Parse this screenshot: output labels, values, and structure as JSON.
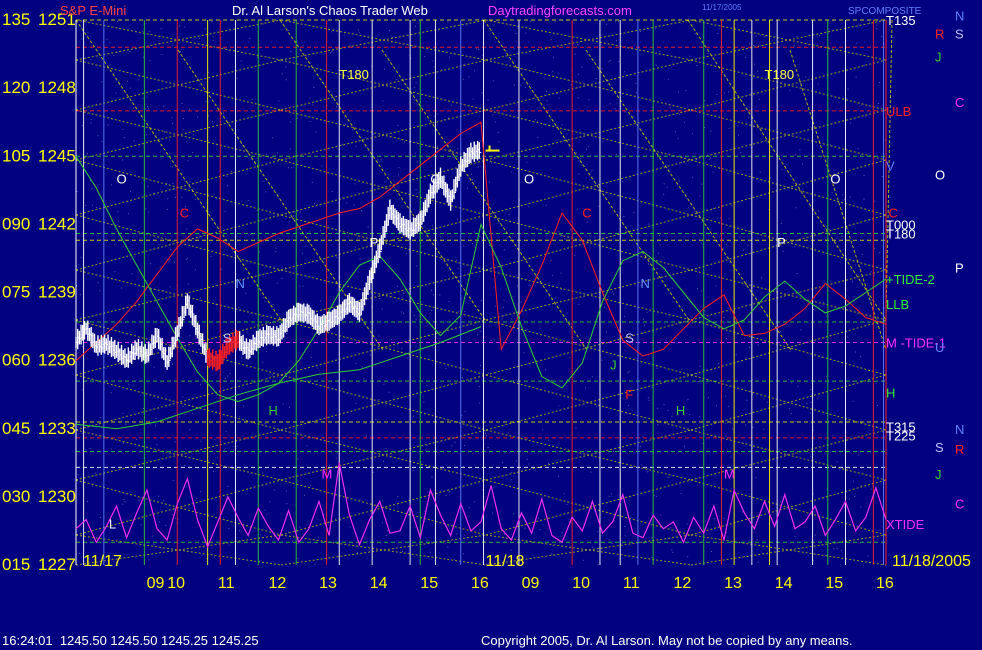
{
  "header": {
    "instrument": "S&P E-Mini",
    "title": "Dr. Al Larson's Chaos Trader Web",
    "site": "Daytradingforecasts.com",
    "small_stamp": "11/17/2005",
    "corner_label": "SPCOMPOSITE"
  },
  "footer": {
    "quote": "16:24:01  1245.50 1245.50 1245.25 1245.25",
    "copyright": "Copyright 2005, Dr. Al Larson. May not be copied by any means."
  },
  "colors": {
    "background": "#000080",
    "axis_text": "#ffff00",
    "price_bars": "#ffffff",
    "red_band": "#ff2020",
    "green_band": "#33cc33",
    "xtide": "#ee30ee",
    "yellow_grid": "#e8e800",
    "header_left": "#ff4444",
    "header_site": "#ff44ff"
  },
  "chart_data": {
    "type": "line",
    "y_left": {
      "ticks": [
        {
          "deg": "135",
          "price": "1251",
          "value": 1251
        },
        {
          "deg": "120",
          "price": "1248",
          "value": 1248
        },
        {
          "deg": "105",
          "price": "1245",
          "value": 1245
        },
        {
          "deg": "090",
          "price": "1242",
          "value": 1242
        },
        {
          "deg": "075",
          "price": "1239",
          "value": 1239
        },
        {
          "deg": "060",
          "price": "1236",
          "value": 1236
        },
        {
          "deg": "045",
          "price": "1233",
          "value": 1233
        },
        {
          "deg": "030",
          "price": "1230",
          "value": 1230
        },
        {
          "deg": "015",
          "price": "1227",
          "value": 1227
        }
      ],
      "ylim": [
        1227,
        1251
      ]
    },
    "x_axis": {
      "xlim": [
        8.0,
        24.0
      ],
      "hour_ticks": [
        {
          "label": "09",
          "x": 9
        },
        {
          "label": "10",
          "x": 10
        },
        {
          "label": "11",
          "x": 11
        },
        {
          "label": "12",
          "x": 12
        },
        {
          "label": "13",
          "x": 13
        },
        {
          "label": "14",
          "x": 14
        },
        {
          "label": "15",
          "x": 15
        },
        {
          "label": "16",
          "x": 16
        },
        {
          "label": "09",
          "x": 17
        },
        {
          "label": "10",
          "x": 18
        },
        {
          "label": "11",
          "x": 19
        },
        {
          "label": "12",
          "x": 20
        },
        {
          "label": "13",
          "x": 21
        },
        {
          "label": "14",
          "x": 22
        },
        {
          "label": "15",
          "x": 23
        },
        {
          "label": "16",
          "x": 24
        }
      ],
      "date_labels": [
        {
          "label": "11/17",
          "x": 8.1
        },
        {
          "label": "11/18",
          "x": 16.05
        },
        {
          "label": "11/18/2005",
          "x": 24.0
        }
      ]
    },
    "price_series": {
      "name": "",
      "x": [
        8.0,
        8.2,
        8.4,
        8.6,
        8.8,
        9.0,
        9.2,
        9.4,
        9.6,
        9.8,
        10.0,
        10.2,
        10.4,
        10.6,
        10.8,
        11.0,
        11.2,
        11.4,
        11.6,
        11.8,
        12.0,
        12.2,
        12.4,
        12.6,
        12.8,
        13.0,
        13.2,
        13.4,
        13.6,
        13.8,
        14.0,
        14.2,
        14.4,
        14.6,
        14.8,
        15.0,
        15.2,
        15.4,
        15.6,
        15.8,
        16.0
      ],
      "y": [
        1236.8,
        1237.4,
        1236.6,
        1236.7,
        1236.4,
        1236.0,
        1236.5,
        1236.2,
        1237.1,
        1235.9,
        1237.2,
        1238.6,
        1237.3,
        1236.1,
        1235.9,
        1236.6,
        1236.9,
        1236.4,
        1236.9,
        1237.1,
        1237.0,
        1237.8,
        1238.1,
        1238.0,
        1237.5,
        1237.7,
        1238.0,
        1238.5,
        1238.1,
        1239.5,
        1240.9,
        1242.6,
        1242.0,
        1241.7,
        1242.1,
        1243.3,
        1244.0,
        1243.0,
        1244.5,
        1245.1,
        1245.25
      ]
    },
    "red_section": {
      "x_start": 10.6,
      "x_end": 11.2
    },
    "last_price": {
      "x": 16.05,
      "value": 1245.25
    },
    "series": [
      {
        "name": "",
        "color": "#ff2020",
        "x": [
          8.0,
          8.4,
          8.8,
          9.2,
          9.6,
          10.0,
          10.4,
          10.8,
          11.2,
          11.6,
          12.0,
          12.4,
          12.8,
          13.2,
          13.6,
          14.0,
          14.4,
          14.8,
          15.2,
          15.6,
          16.0,
          16.4,
          16.8,
          17.2,
          17.6,
          18.0,
          18.4,
          18.8,
          19.2,
          19.6,
          20.0,
          20.4,
          20.8,
          21.2,
          21.6,
          22.0,
          22.4,
          22.8,
          23.2,
          23.6,
          24.0
        ],
        "y": [
          1236.0,
          1236.8,
          1237.6,
          1238.6,
          1239.8,
          1241.0,
          1241.8,
          1241.4,
          1240.8,
          1241.2,
          1241.6,
          1241.9,
          1242.2,
          1242.5,
          1242.7,
          1243.2,
          1243.9,
          1244.6,
          1245.3,
          1246.0,
          1246.5,
          1236.5,
          1238.2,
          1240.2,
          1242.5,
          1241.3,
          1239.0,
          1236.9,
          1236.2,
          1236.5,
          1237.4,
          1238.3,
          1238.9,
          1237.1,
          1237.2,
          1237.6,
          1238.3,
          1239.4,
          1238.7,
          1237.9,
          1237.6
        ]
      },
      {
        "name": "",
        "color": "#33cc33",
        "x": [
          8.0,
          8.4,
          8.8,
          9.2,
          9.6,
          10.0,
          10.4,
          10.8,
          11.2,
          11.6,
          12.0,
          12.4,
          12.8,
          13.2,
          13.6,
          14.0,
          14.4,
          14.8,
          15.2,
          15.6,
          16.0,
          16.4,
          16.8,
          17.2,
          17.6,
          18.0,
          18.4,
          18.8,
          19.2,
          19.6,
          20.0,
          20.4,
          20.8,
          21.2,
          21.6,
          22.0,
          22.4,
          22.8,
          23.2,
          23.6,
          24.0
        ],
        "y": [
          1245.0,
          1243.6,
          1241.8,
          1240.2,
          1238.6,
          1237.0,
          1235.5,
          1234.5,
          1234.2,
          1234.5,
          1235.0,
          1236.0,
          1237.4,
          1239.0,
          1240.2,
          1240.6,
          1239.6,
          1238.1,
          1237.1,
          1238.0,
          1242.0,
          1240.1,
          1237.5,
          1235.3,
          1234.8,
          1235.9,
          1238.6,
          1240.4,
          1240.8,
          1240.1,
          1239.0,
          1237.9,
          1237.4,
          1237.8,
          1238.8,
          1239.5,
          1238.7,
          1238.1,
          1238.4,
          1239.0,
          1239.6
        ]
      },
      {
        "name": "",
        "color": "#33cc33",
        "x": [
          8.0,
          8.8,
          9.6,
          10.4,
          11.2,
          12.0,
          12.8,
          13.6,
          14.4,
          15.2,
          16.0
        ],
        "y": [
          1233.2,
          1233.0,
          1233.3,
          1233.9,
          1234.5,
          1235.0,
          1235.4,
          1235.6,
          1236.2,
          1236.8,
          1237.5
        ]
      }
    ],
    "xtide": {
      "name": "",
      "color": "#ee30ee",
      "x": [
        8.0,
        8.2,
        8.4,
        8.6,
        8.8,
        9.0,
        9.2,
        9.4,
        9.6,
        9.8,
        10.0,
        10.2,
        10.4,
        10.6,
        10.8,
        11.0,
        11.2,
        11.4,
        11.6,
        11.8,
        12.0,
        12.2,
        12.4,
        12.6,
        12.8,
        13.0,
        13.2,
        13.4,
        13.6,
        13.8,
        14.0,
        14.2,
        14.4,
        14.6,
        14.8,
        15.0,
        15.2,
        15.4,
        15.6,
        15.8,
        16.0,
        16.2,
        16.4,
        16.6,
        16.8,
        17.0,
        17.2,
        17.4,
        17.6,
        17.8,
        18.0,
        18.2,
        18.4,
        18.6,
        18.8,
        19.0,
        19.2,
        19.4,
        19.6,
        19.8,
        20.0,
        20.2,
        20.4,
        20.6,
        20.8,
        21.0,
        21.2,
        21.4,
        21.6,
        21.8,
        22.0,
        22.2,
        22.4,
        22.6,
        22.8,
        23.0,
        23.2,
        23.4,
        23.6,
        23.8,
        24.0
      ],
      "y": [
        1228.6,
        1229.0,
        1228.0,
        1228.7,
        1229.6,
        1228.2,
        1229.3,
        1230.3,
        1228.6,
        1228.1,
        1229.7,
        1230.8,
        1229.0,
        1227.8,
        1228.9,
        1230.0,
        1229.1,
        1228.3,
        1229.5,
        1228.7,
        1228.1,
        1229.4,
        1228.0,
        1228.6,
        1229.8,
        1228.3,
        1231.5,
        1229.2,
        1227.9,
        1229.0,
        1229.8,
        1228.4,
        1228.5,
        1229.6,
        1228.2,
        1230.3,
        1229.2,
        1228.3,
        1229.7,
        1228.5,
        1228.9,
        1230.5,
        1228.6,
        1228.1,
        1229.3,
        1228.4,
        1229.9,
        1228.3,
        1228.0,
        1229.1,
        1228.5,
        1229.8,
        1228.4,
        1228.9,
        1230.1,
        1228.4,
        1228.2,
        1229.2,
        1228.6,
        1228.9,
        1228.0,
        1229.1,
        1228.4,
        1229.6,
        1228.1,
        1230.3,
        1229.3,
        1228.6,
        1229.8,
        1228.7,
        1230.1,
        1228.6,
        1228.9,
        1229.6,
        1228.3,
        1229.0,
        1229.8,
        1228.5,
        1229.1,
        1230.4,
        1229.0
      ]
    },
    "horizontal_levels": [
      {
        "value": 1251.0,
        "color": "#e8e800"
      },
      {
        "value": 1249.8,
        "color": "#ff2020"
      },
      {
        "value": 1247.0,
        "color": "#ff2020"
      },
      {
        "value": 1245.0,
        "color": "#33cc33"
      },
      {
        "value": 1241.6,
        "color": "#33cc33"
      },
      {
        "value": 1241.3,
        "color": "#e8e800"
      },
      {
        "value": 1237.7,
        "color": "#33cc33"
      },
      {
        "value": 1236.8,
        "color": "#ff30ff"
      },
      {
        "value": 1235.1,
        "color": "#33cc33"
      },
      {
        "value": 1233.3,
        "color": "#e8e800"
      },
      {
        "value": 1232.6,
        "color": "#ff2020"
      },
      {
        "value": 1232.0,
        "color": "#33cc33"
      },
      {
        "value": 1231.3,
        "color": "#ffffff"
      },
      {
        "value": 1228.0,
        "color": "#33cc33"
      }
    ],
    "vertical_lines": [
      {
        "x": 8.15,
        "color": "#ffffff"
      },
      {
        "x": 8.55,
        "color": "#6080ff"
      },
      {
        "x": 9.35,
        "color": "#33cc33"
      },
      {
        "x": 10.0,
        "color": "#ff2020"
      },
      {
        "x": 10.6,
        "color": "#ffff00"
      },
      {
        "x": 10.85,
        "color": "#ff2020"
      },
      {
        "x": 11.15,
        "color": "#ffffff"
      },
      {
        "x": 11.6,
        "color": "#33cc33"
      },
      {
        "x": 12.35,
        "color": "#33cc33"
      },
      {
        "x": 12.95,
        "color": "#ff2020"
      },
      {
        "x": 13.2,
        "color": "#ffffff"
      },
      {
        "x": 13.85,
        "color": "#ffffff"
      },
      {
        "x": 14.6,
        "color": "#ffffff"
      },
      {
        "x": 14.8,
        "color": "#33cc33"
      },
      {
        "x": 15.1,
        "color": "#ffffff"
      },
      {
        "x": 15.6,
        "color": "#6080ff"
      },
      {
        "x": 16.05,
        "color": "#ffffff"
      },
      {
        "x": 16.75,
        "color": "#ffffff"
      },
      {
        "x": 17.8,
        "color": "#ff2020"
      },
      {
        "x": 18.35,
        "color": "#ffffff"
      },
      {
        "x": 18.75,
        "color": "#ffffff"
      },
      {
        "x": 19.1,
        "color": "#6080ff"
      },
      {
        "x": 19.4,
        "color": "#33cc33"
      },
      {
        "x": 20.4,
        "color": "#33cc33"
      },
      {
        "x": 20.75,
        "color": "#ff2020"
      },
      {
        "x": 21.0,
        "color": "#ffff00"
      },
      {
        "x": 21.35,
        "color": "#ffffff"
      },
      {
        "x": 21.7,
        "color": "#ffff00"
      },
      {
        "x": 21.85,
        "color": "#ffffff"
      },
      {
        "x": 22.55,
        "color": "#ffffff"
      },
      {
        "x": 22.85,
        "color": "#33cc33"
      },
      {
        "x": 23.2,
        "color": "#ffffff"
      },
      {
        "x": 23.75,
        "color": "#ff2020"
      },
      {
        "x": 23.95,
        "color": "#6080ff"
      }
    ],
    "annotations": [
      {
        "text": "T180",
        "x": 13.2,
        "y": 1248.4,
        "color": "#ffff40"
      },
      {
        "text": "T180",
        "x": 21.6,
        "y": 1248.4,
        "color": "#ffff40"
      },
      {
        "text": "O",
        "x": 8.8,
        "y": 1243.8,
        "color": "#ffffff"
      },
      {
        "text": "O",
        "x": 15.0,
        "y": 1243.8,
        "color": "#ffffff"
      },
      {
        "text": "O",
        "x": 16.85,
        "y": 1243.8,
        "color": "#ffffff"
      },
      {
        "text": "O",
        "x": 22.9,
        "y": 1243.8,
        "color": "#ffffff"
      },
      {
        "text": "C",
        "x": 10.05,
        "y": 1242.3,
        "color": "#ff2020"
      },
      {
        "text": "C",
        "x": 18.0,
        "y": 1242.3,
        "color": "#ff2020"
      },
      {
        "text": "C",
        "x": 24.05,
        "y": 1242.3,
        "color": "#ff2020"
      },
      {
        "text": "N",
        "x": 11.15,
        "y": 1239.2,
        "color": "#6090ff"
      },
      {
        "text": "N",
        "x": 19.15,
        "y": 1239.2,
        "color": "#6090ff"
      },
      {
        "text": "P",
        "x": 13.8,
        "y": 1241.0,
        "color": "#ffffff"
      },
      {
        "text": "P",
        "x": 21.85,
        "y": 1241.0,
        "color": "#ffffff"
      },
      {
        "text": "S",
        "x": 10.9,
        "y": 1236.8,
        "color": "#c0c0ff"
      },
      {
        "text": "S",
        "x": 18.85,
        "y": 1236.8,
        "color": "#c0c0ff"
      },
      {
        "text": "J",
        "x": 18.55,
        "y": 1235.6,
        "color": "#33cc33"
      },
      {
        "text": "F",
        "x": 18.85,
        "y": 1234.3,
        "color": "#ff2020"
      },
      {
        "text": "H",
        "x": 11.8,
        "y": 1233.6,
        "color": "#33cc33"
      },
      {
        "text": "H",
        "x": 19.85,
        "y": 1233.6,
        "color": "#33cc33"
      },
      {
        "text": "M",
        "x": 12.85,
        "y": 1230.8,
        "color": "#ff30ff"
      },
      {
        "text": "M",
        "x": 20.8,
        "y": 1230.8,
        "color": "#ff30ff"
      },
      {
        "text": "L",
        "x": 8.65,
        "y": 1228.6,
        "color": "#ffffff"
      }
    ],
    "right_labels": [
      {
        "text": "T135",
        "value": 1251.0,
        "color": "#ffffff"
      },
      {
        "text": "ULB",
        "value": 1247.0,
        "color": "#ff2020"
      },
      {
        "text": "V",
        "value": 1244.6,
        "color": "#6080ff"
      },
      {
        "text": "T000",
        "value": 1242.0,
        "color": "#ffffff"
      },
      {
        "text": "T180",
        "value": 1241.6,
        "color": "#ffffff"
      },
      {
        "text": "+TIDE-2",
        "value": 1239.6,
        "color": "#33ee33"
      },
      {
        "text": "LLB",
        "value": 1238.5,
        "color": "#33ee33"
      },
      {
        "text": "M -TIDE-1",
        "value": 1236.8,
        "color": "#ff30ff"
      },
      {
        "text": "H",
        "value": 1234.6,
        "color": "#33ee33"
      },
      {
        "text": "T315",
        "value": 1233.1,
        "color": "#ffffff"
      },
      {
        "text": "T225",
        "value": 1232.7,
        "color": "#ffffff"
      },
      {
        "text": "XTIDE",
        "value": 1228.8,
        "color": "#ff30ff"
      }
    ],
    "far_right_labels": [
      {
        "text": "N",
        "value": 1251.2,
        "color": "#6080ff"
      },
      {
        "text": "R",
        "value": 1250.4,
        "color": "#ff2020"
      },
      {
        "text": "S",
        "value": 1250.4,
        "color": "#c0c0ff"
      },
      {
        "text": "J",
        "value": 1249.4,
        "color": "#33cc33"
      },
      {
        "text": "C",
        "value": 1247.4,
        "color": "#ff30ff"
      },
      {
        "text": "O",
        "value": 1244.2,
        "color": "#ffffff"
      },
      {
        "text": "P",
        "value": 1240.1,
        "color": "#ffffff"
      },
      {
        "text": "U",
        "value": 1236.6,
        "color": "#6080ff"
      },
      {
        "text": "N",
        "value": 1233.0,
        "color": "#6080ff"
      },
      {
        "text": "S",
        "value": 1232.2,
        "color": "#c0c0ff"
      },
      {
        "text": "R",
        "value": 1232.1,
        "color": "#ff2020"
      },
      {
        "text": "J",
        "value": 1231.0,
        "color": "#33cc33"
      },
      {
        "text": "C",
        "value": 1229.7,
        "color": "#ff30ff"
      }
    ]
  }
}
